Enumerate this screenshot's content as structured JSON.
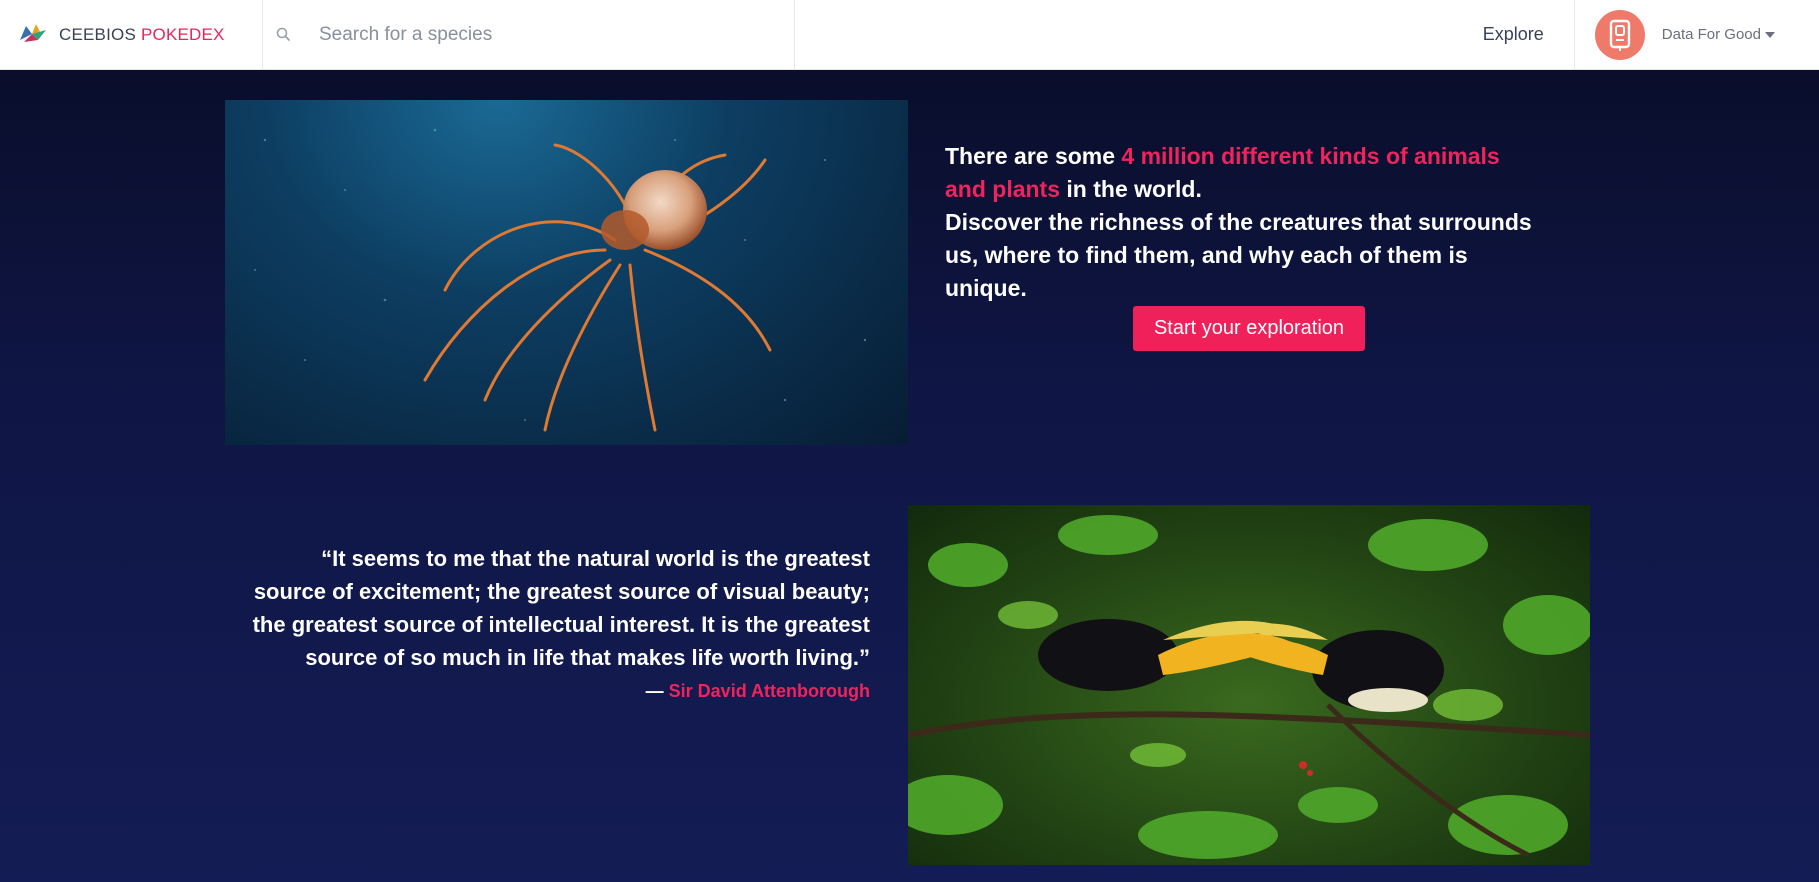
{
  "navbar": {
    "brand_prefix": "CEEBIOS",
    "brand_accent": "POKEDEX",
    "search_placeholder": "Search for a species",
    "explore_label": "Explore",
    "user_label": "Data For Good"
  },
  "hero": {
    "intro_start": "There are some ",
    "intro_highlight": "4 million different kinds of animals and plants",
    "intro_end": " in the world.",
    "discover_text": "Discover the richness of the creatures that surrounds us, where to find them, and why each of them is unique.",
    "cta_label": "Start your exploration"
  },
  "quote": {
    "text": "“It seems to me that the natural world is the greatest source of excitement; the greatest source of visual beauty; the greatest source of intellectual interest. It is the greatest source of so much in life that makes life worth living.”",
    "dash": "— ",
    "author": "Sir David Attenborough"
  },
  "colors": {
    "accent": "#f0245c",
    "background_top": "#090c26",
    "background_bottom": "#141c55",
    "avatar": "#f07a6a"
  },
  "icons": {
    "brand": "bird-logo-icon",
    "search": "search-icon",
    "avatar": "data-for-good-logo-icon",
    "dropdown": "caret-down-icon"
  }
}
